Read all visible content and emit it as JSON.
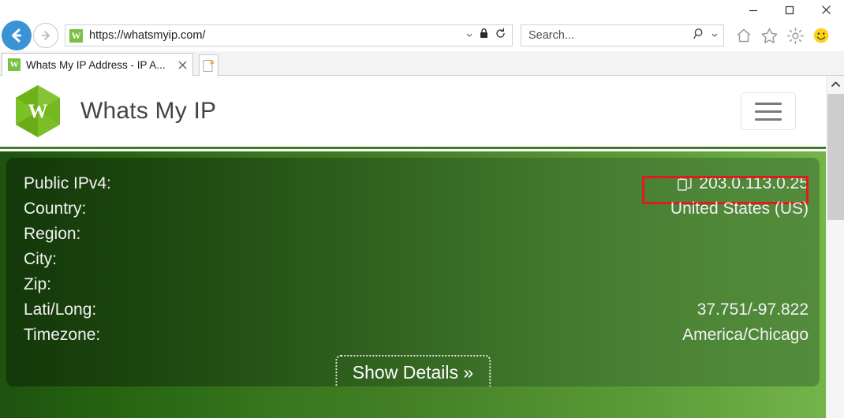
{
  "window": {
    "minimize_label": "Minimize",
    "maximize_label": "Maximize",
    "close_label": "Close"
  },
  "browser": {
    "back_label": "Back",
    "forward_label": "Forward",
    "url": "https://whatsmyip.com/",
    "favicon_letter": "W",
    "address_dropdown_icon": "chevron-down-icon",
    "lock_icon": "padlock-icon",
    "refresh_icon": "refresh-icon",
    "search_placeholder": "Search...",
    "search_icon": "magnifier-icon",
    "search_dropdown_icon": "chevron-down-icon",
    "home_icon": "home-icon",
    "favorites_icon": "star-icon",
    "tools_icon": "gear-icon",
    "feedback_icon": "smiley-icon",
    "tab": {
      "title": "Whats My IP Address - IP A...",
      "favicon_letter": "W",
      "close_label": "×"
    },
    "new_tab_label": "New tab"
  },
  "site": {
    "logo_letter": "W",
    "name": "Whats My IP",
    "menu_label": "Menu"
  },
  "ip_panel": {
    "rows": [
      {
        "label": "Public IPv4:",
        "value": "203.0.113.0.25",
        "has_copy_icon": true,
        "highlighted": true
      },
      {
        "label": "Country:",
        "value": "United States (US)",
        "has_copy_icon": false,
        "highlighted": false
      },
      {
        "label": "Region:",
        "value": "",
        "has_copy_icon": false,
        "highlighted": false
      },
      {
        "label": "City:",
        "value": "",
        "has_copy_icon": false,
        "highlighted": false
      },
      {
        "label": "Zip:",
        "value": "",
        "has_copy_icon": false,
        "highlighted": false
      },
      {
        "label": "Lati/Long:",
        "value": "37.751/-97.822",
        "has_copy_icon": false,
        "highlighted": false
      },
      {
        "label": "Timezone:",
        "value": "America/Chicago",
        "has_copy_icon": false,
        "highlighted": false
      }
    ],
    "copy_icon": "copy-to-clipboard-icon",
    "show_details_label": "Show Details »",
    "highlight_color": "#e01b1b",
    "panel_gradient_from": "#13380a",
    "panel_gradient_to": "#548c3d",
    "band_gradient_from": "#1e5210",
    "band_gradient_to": "#74b54a"
  },
  "scrollbar": {
    "up_arrow_icon": "chevron-up-icon"
  }
}
